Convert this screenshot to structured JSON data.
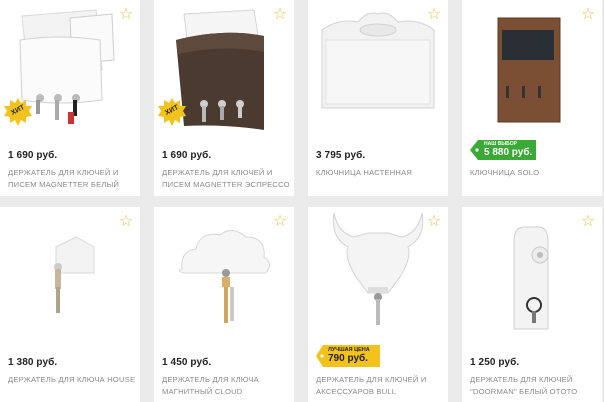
{
  "products": [
    {
      "price": "1 690 руб.",
      "title": "ДЕРЖАТЕЛЬ ДЛЯ КЛЮЧЕЙ И ПИСЕМ MAGNETTER БЕЛЫЙ",
      "badge": "ХИТ"
    },
    {
      "price": "1 690 руб.",
      "title": "ДЕРЖАТЕЛЬ ДЛЯ КЛЮЧЕЙ И ПИСЕМ MAGNETTER ЭСПРЕССО",
      "badge": "ХИТ"
    },
    {
      "price": "3 795 руб.",
      "title": "КЛЮЧНИЦА НАСТЕННАЯ"
    },
    {
      "price": "5 880 руб.",
      "title": "КЛЮЧНИЦА SOLO",
      "badge_label": "НАШ ВЫБОР"
    },
    {
      "price": "1 380 руб.",
      "title": "ДЕРЖАТЕЛЬ ДЛЯ КЛЮЧА HOUSE"
    },
    {
      "price": "1 450 руб.",
      "title": "ДЕРЖАТЕЛЬ ДЛЯ КЛЮЧА МАГНИТНЫЙ CLOUD"
    },
    {
      "price": "790 руб.",
      "title": "ДЕРЖАТЕЛЬ ДЛЯ КЛЮЧЕЙ И АКСЕССУАРОВ BULL",
      "badge_label": "ЛУЧШАЯ ЦЕНА"
    },
    {
      "price": "1 250 руб.",
      "title": "ДЕРЖАТЕЛЬ ДЛЯ КЛЮЧЕЙ \"DOORMAN\" БЕЛЫЙ OTOTO"
    }
  ],
  "icons": {
    "favorite": "star-outline-icon"
  },
  "colors": {
    "star": "#e8c23a",
    "hit_badge": "#f4c21c",
    "choice_badge": "#3aa935",
    "best_badge": "#f4c21c",
    "title_text": "#8a8a8a"
  }
}
